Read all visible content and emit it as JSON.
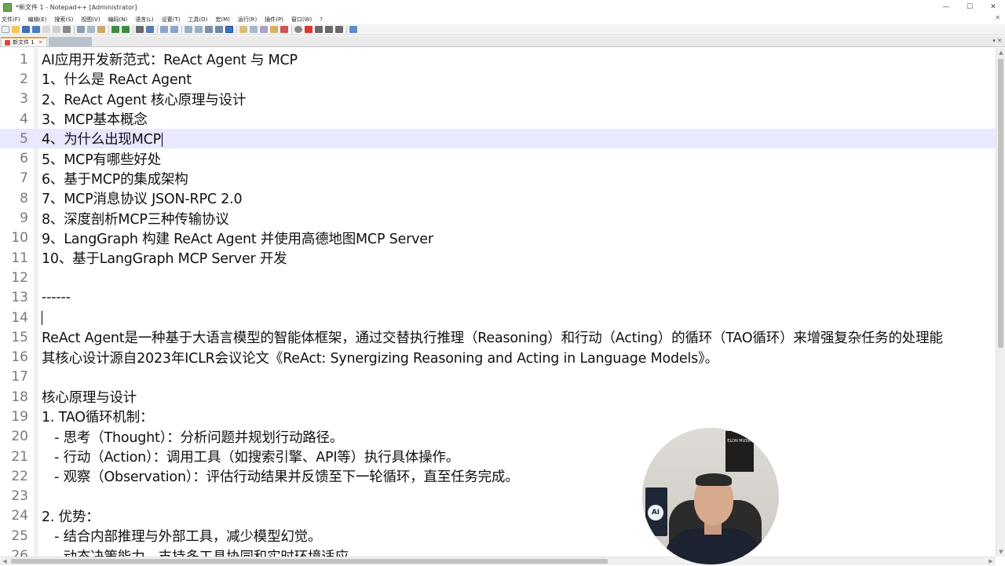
{
  "window": {
    "title": "*新文件 1 - Notepad++ [Administrator]",
    "controls": {
      "minimize": "—",
      "maximize": "☐",
      "close": "✕"
    }
  },
  "menu": {
    "items": [
      "文件(F)",
      "编辑(E)",
      "搜索(S)",
      "视图(V)",
      "编码(N)",
      "语言(L)",
      "设置(T)",
      "工具(O)",
      "宏(M)",
      "运行(R)",
      "插件(P)",
      "窗口(W)",
      "?"
    ],
    "close_glyph": "✕"
  },
  "tabs": {
    "active_label": "新文件 1",
    "close_glyph": "✕",
    "overflow": "▾ ✕"
  },
  "editor": {
    "current_line": 5,
    "caret_line": 14,
    "lines": [
      {
        "n": "1",
        "text": "AI应用开发新范式：ReAct Agent 与 MCP"
      },
      {
        "n": "2",
        "text": "1、什么是 ReAct Agent"
      },
      {
        "n": "3",
        "text": "2、ReAct Agent 核心原理与设计"
      },
      {
        "n": "4",
        "text": "3、MCP基本概念"
      },
      {
        "n": "5",
        "text": "4、为什么出现MCP"
      },
      {
        "n": "6",
        "text": "5、MCP有哪些好处"
      },
      {
        "n": "7",
        "text": "6、基于MCP的集成架构"
      },
      {
        "n": "8",
        "text": "7、MCP消息协议 JSON-RPC 2.0"
      },
      {
        "n": "9",
        "text": "8、深度剖析MCP三种传输协议"
      },
      {
        "n": "10",
        "text": "9、LangGraph 构建 ReAct Agent 并使用高德地图MCP Server"
      },
      {
        "n": "11",
        "text": "10、基于LangGraph MCP Server 开发"
      },
      {
        "n": "12",
        "text": ""
      },
      {
        "n": "13",
        "text": "------"
      },
      {
        "n": "14",
        "text": ""
      },
      {
        "n": "15",
        "text": "ReAct Agent是一种基于大语言模型的智能体框架，通过交替执行推理（Reasoning）和行动（Acting）的循环（TAO循环）来增强复杂任务的处理能"
      },
      {
        "n": "16",
        "text": "其核心设计源自2023年ICLR会议论文《ReAct: Synergizing Reasoning and Acting in Language Models》。"
      },
      {
        "n": "17",
        "text": ""
      },
      {
        "n": "18",
        "text": "核心原理与设计"
      },
      {
        "n": "19",
        "text": "1. TAO循环机制："
      },
      {
        "n": "20",
        "text": "   - 思考（Thought）：分析问题并规划行动路径。"
      },
      {
        "n": "21",
        "text": "   - 行动（Action）：调用工具（如搜索引擎、API等）执行具体操作。"
      },
      {
        "n": "22",
        "text": "   - 观察（Observation）：评估行动结果并反馈至下一轮循环，直至任务完成。"
      },
      {
        "n": "23",
        "text": ""
      },
      {
        "n": "24",
        "text": "2. 优势："
      },
      {
        "n": "25",
        "text": "   - 结合内部推理与外部工具，减少模型幻觉。"
      },
      {
        "n": "26",
        "text": "   - 动态决策能力，支持多工具协同和实时环境适应"
      }
    ]
  },
  "webcam": {
    "book_label": "ELON MUSK",
    "sign_label": "AI"
  },
  "colors": {
    "current_line_bg": "#e8e8ff",
    "tab_accent": "#f29e26"
  }
}
